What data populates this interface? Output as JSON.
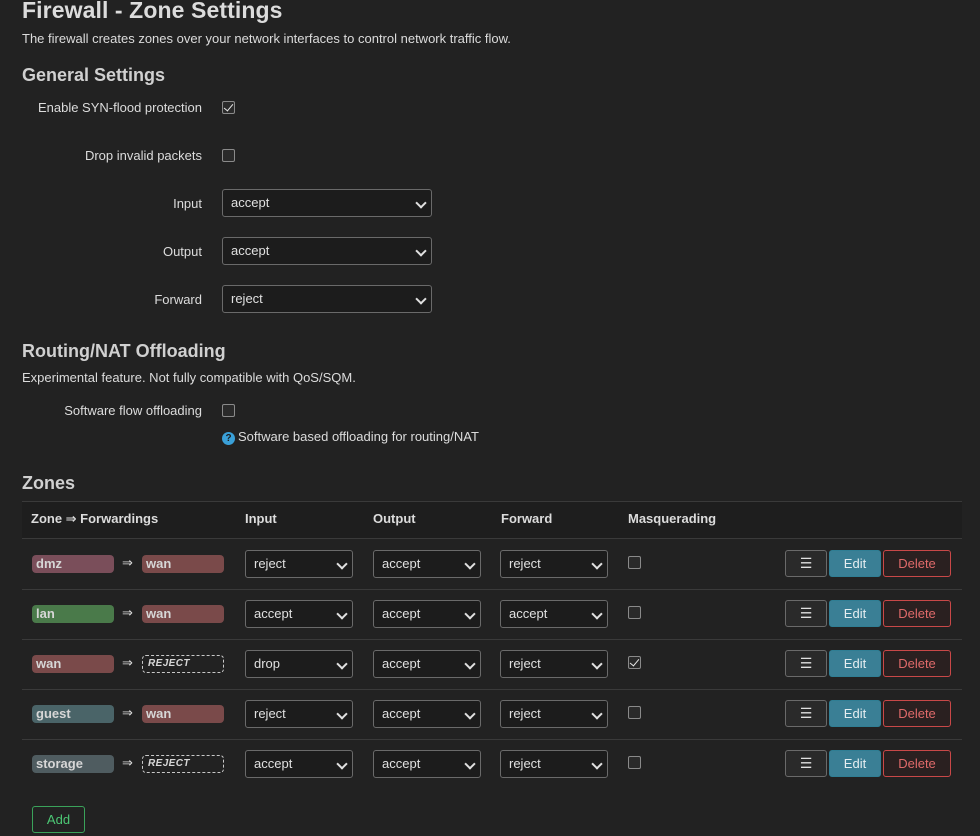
{
  "page": {
    "title": "Firewall - Zone Settings",
    "description": "The firewall creates zones over your network interfaces to control network traffic flow."
  },
  "general": {
    "heading": "General Settings",
    "syn_flood": {
      "label": "Enable SYN-flood protection",
      "checked": true
    },
    "drop_invalid": {
      "label": "Drop invalid packets",
      "checked": false
    },
    "input": {
      "label": "Input",
      "value": "accept"
    },
    "output": {
      "label": "Output",
      "value": "accept"
    },
    "forward": {
      "label": "Forward",
      "value": "reject"
    }
  },
  "offloading": {
    "heading": "Routing/NAT Offloading",
    "description": "Experimental feature. Not fully compatible with QoS/SQM.",
    "software_flow": {
      "label": "Software flow offloading",
      "checked": false
    },
    "hint": "Software based offloading for routing/NAT",
    "hint_icon": "help-icon"
  },
  "zones": {
    "heading": "Zones",
    "columns": {
      "zone": "Zone ⇒ Forwardings",
      "input": "Input",
      "output": "Output",
      "forward": "Forward",
      "masquerading": "Masquerading"
    },
    "arrow": "⇒",
    "menu_icon": "☰",
    "edit_label": "Edit",
    "delete_label": "Delete",
    "add_label": "Add",
    "rows": [
      {
        "name": "dmz",
        "name_color": "#7a4e5a",
        "forward_to": "wan",
        "forward_color": "#7a4a4a",
        "forward_reject": false,
        "input": "reject",
        "output": "accept",
        "forward": "reject",
        "masq": false
      },
      {
        "name": "lan",
        "name_color": "#4a7a4a",
        "forward_to": "wan",
        "forward_color": "#7a4a4a",
        "forward_reject": false,
        "input": "accept",
        "output": "accept",
        "forward": "accept",
        "masq": false
      },
      {
        "name": "wan",
        "name_color": "#7a4a4a",
        "forward_to": "REJECT",
        "forward_color": "",
        "forward_reject": true,
        "input": "drop",
        "output": "accept",
        "forward": "reject",
        "masq": true
      },
      {
        "name": "guest",
        "name_color": "#4a6468",
        "forward_to": "wan",
        "forward_color": "#7a4a4a",
        "forward_reject": false,
        "input": "reject",
        "output": "accept",
        "forward": "reject",
        "masq": false
      },
      {
        "name": "storage",
        "name_color": "#4f5c60",
        "forward_to": "REJECT",
        "forward_color": "",
        "forward_reject": true,
        "input": "accept",
        "output": "accept",
        "forward": "reject",
        "masq": false
      }
    ]
  },
  "colors": {
    "background": "#222222",
    "edit_button": "#3a7f95",
    "delete_button": "#e06a6a",
    "add_button": "#4cc774",
    "hint_icon": "#3aa0d8"
  }
}
